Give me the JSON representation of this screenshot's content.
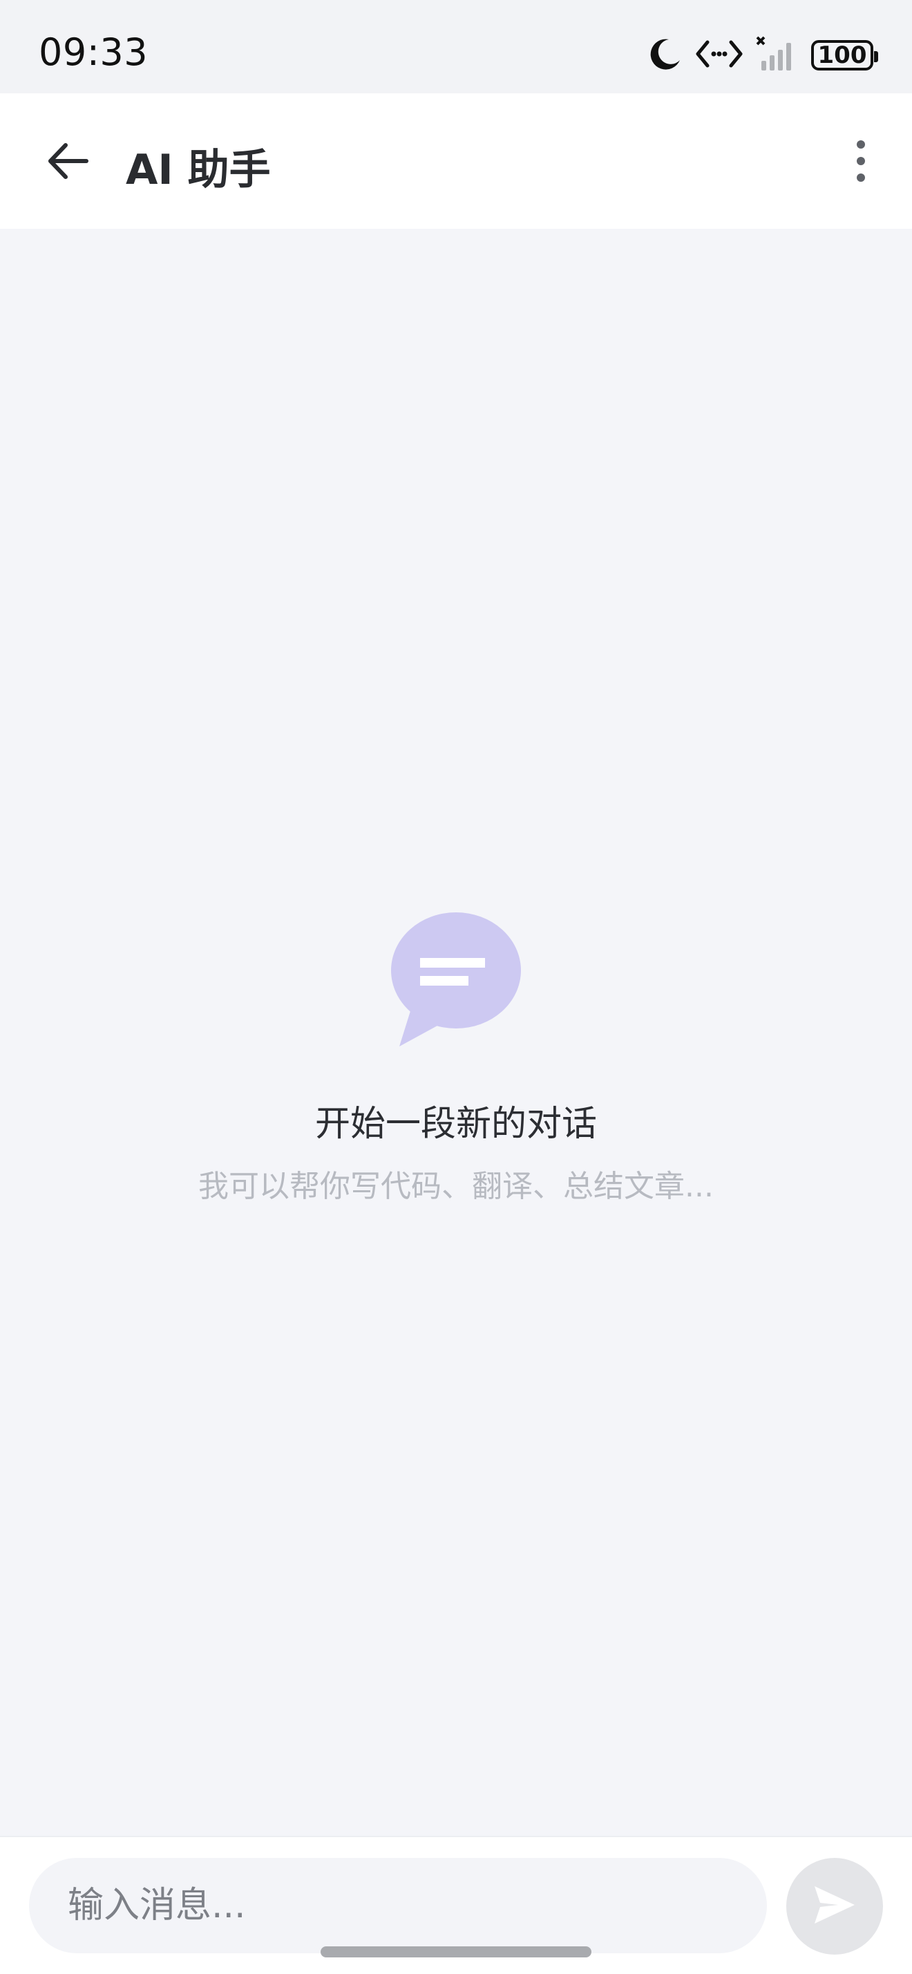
{
  "status_bar": {
    "time": "09:33",
    "battery": "100",
    "icons": [
      "moon-icon",
      "data-transfer-icon",
      "no-signal-icon",
      "battery-icon"
    ]
  },
  "header": {
    "title": "AI 助手",
    "back_icon": "arrow-left-icon",
    "menu_icon": "more-vertical-icon"
  },
  "empty_state": {
    "icon": "chat-bubble-icon",
    "title": "开始一段新的对话",
    "subtitle": "我可以帮你写代码、翻译、总结文章..."
  },
  "composer": {
    "placeholder": "输入消息...",
    "value": "",
    "send_icon": "send-icon"
  },
  "colors": {
    "background": "#f4f5f9",
    "app_bar": "#ffffff",
    "accent_bubble": "#cdc9f2",
    "send_button_disabled": "#e4e5e8",
    "subtitle_text": "#b7bac1"
  }
}
